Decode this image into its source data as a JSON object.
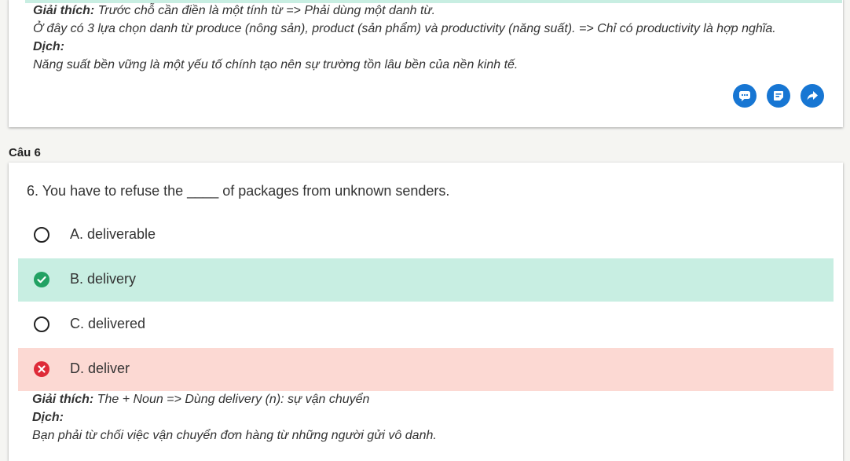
{
  "prev_explanation": {
    "label": "Giải thích:",
    "text": " Trước chỗ cần điền là một tính từ => Phải dùng một danh từ.",
    "line2": "Ở đây có 3 lựa chọn danh từ produce (nông sản), product (sản phẩm) và productivity (năng suất). => Chỉ có productivity là hợp nghĩa.",
    "translate_label": "Dịch:",
    "translation": "Năng suất bền vững là một yếu tố chính tạo nên sự trường tồn lâu bền của nền kinh tế."
  },
  "actions": {
    "icons": [
      "comment-icon",
      "note-icon",
      "share-icon"
    ],
    "color": "#1776d3"
  },
  "question": {
    "header": "Câu 6",
    "text": "6. You have to refuse the ____ of packages from unknown senders.",
    "options": [
      {
        "label": "A. deliverable",
        "state": "unselected"
      },
      {
        "label": "B. delivery",
        "state": "correct"
      },
      {
        "label": "C. delivered",
        "state": "unselected"
      },
      {
        "label": "D. deliver",
        "state": "wrong"
      }
    ],
    "explanation_label": "Giải thích:",
    "explanation": " The + Noun => Dùng delivery (n): sự vận chuyển",
    "translate_label": "Dịch:",
    "translation": "Bạn phải từ chối việc vận chuyển đơn hàng từ những người gửi vô danh."
  },
  "colors": {
    "correct_bg": "#c8eee2",
    "wrong_bg": "#fcd9d3",
    "check": "#22a163",
    "cross": "#de2b38"
  }
}
